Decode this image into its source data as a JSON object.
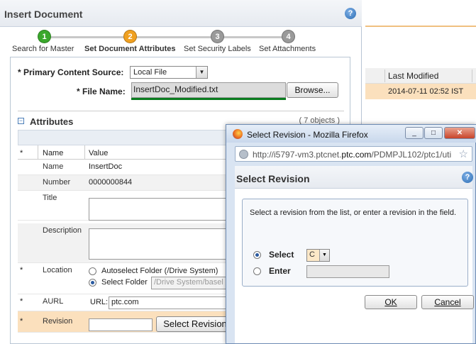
{
  "background": {
    "table_header": "Last Modified",
    "row_value": "2014-07-11 02:52 IST"
  },
  "dialog": {
    "title": "Insert Document",
    "help": "?",
    "steps": [
      {
        "num": "1",
        "label": "Search for Master",
        "color": "#3aa82c"
      },
      {
        "num": "2",
        "label": "Set Document Attributes",
        "color": "#f0a020"
      },
      {
        "num": "3",
        "label": "Set Security Labels",
        "color": "#9a9a9a"
      },
      {
        "num": "4",
        "label": "Set Attachments",
        "color": "#9a9a9a"
      }
    ],
    "primary_source_label": "* Primary Content Source:",
    "primary_source_value": "Local File",
    "file_name_label": "* File Name:",
    "file_name_value": "InsertDoc_Modified.txt",
    "browse_label": "Browse...",
    "attributes": {
      "title": "Attributes",
      "count": "( 7 objects )",
      "collapse": "−",
      "columns": {
        "star": "*",
        "name": "Name",
        "value": "Value"
      },
      "rows": {
        "name": {
          "label": "Name",
          "value": "InsertDoc"
        },
        "number": {
          "label": "Number",
          "value": "0000000844"
        },
        "title": {
          "star": "",
          "label": "Title"
        },
        "description": {
          "label": "Description"
        },
        "location": {
          "star": "*",
          "label": "Location",
          "autoselect": "Autoselect Folder (/Drive System)",
          "select": "Select Folder",
          "folder_value": "/Drive System/basel"
        },
        "aurl": {
          "star": "*",
          "label": "AURL",
          "prefix": "URL:",
          "value": "ptc.com"
        },
        "revision": {
          "star": "*",
          "label": "Revision",
          "button": "Select Revision"
        }
      }
    }
  },
  "popup": {
    "window_title": "Select Revision - Mozilla Firefox",
    "url_prefix": "http://i5797-vm3.ptcnet.",
    "url_domain": "ptc.com",
    "url_suffix": "/PDMPJL102/ptc1/uti",
    "header": "Select Revision",
    "instruction": "Select a revision from the list, or enter a revision in the field.",
    "select_label": "Select",
    "select_value": "C",
    "enter_label": "Enter",
    "ok_label": "OK",
    "cancel_label": "Cancel",
    "minimize": "_",
    "maximize": "□",
    "close": "✕"
  }
}
